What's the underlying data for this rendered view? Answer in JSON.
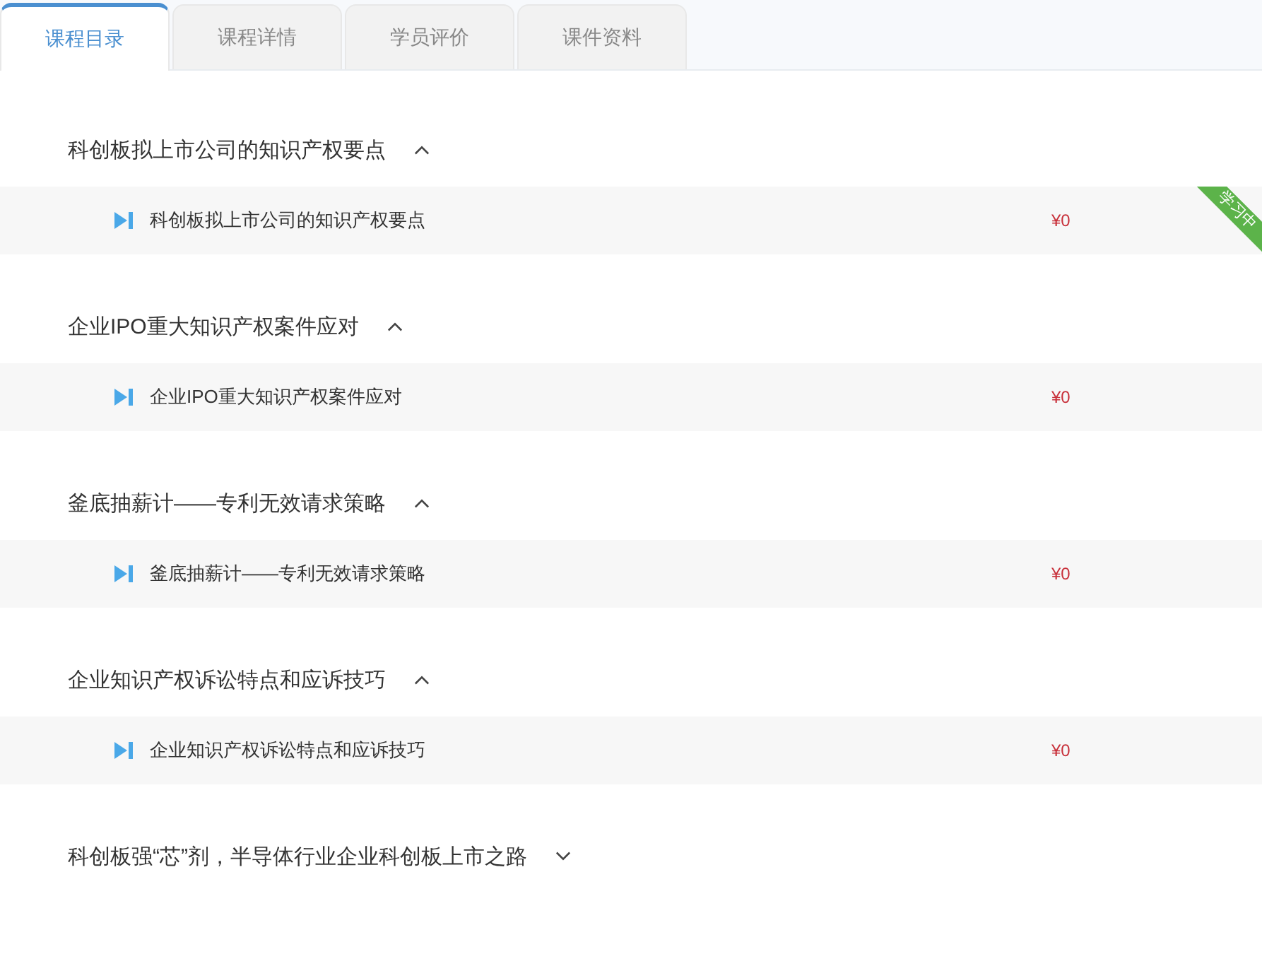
{
  "tabs": [
    {
      "label": "课程目录",
      "selected": true
    },
    {
      "label": "课程详情",
      "selected": false
    },
    {
      "label": "学员评价",
      "selected": false
    },
    {
      "label": "课件资料",
      "selected": false
    }
  ],
  "sections": [
    {
      "title": "科创板拟上市公司的知识产权要点",
      "expanded": true,
      "lessons": [
        {
          "title": "科创板拟上市公司的知识产权要点",
          "price": "¥0",
          "badge": "学习中"
        }
      ]
    },
    {
      "title": "企业IPO重大知识产权案件应对",
      "expanded": true,
      "lessons": [
        {
          "title": "企业IPO重大知识产权案件应对",
          "price": "¥0"
        }
      ]
    },
    {
      "title": "釜底抽薪计——专利无效请求策略",
      "expanded": true,
      "lessons": [
        {
          "title": "釜底抽薪计——专利无效请求策略",
          "price": "¥0"
        }
      ]
    },
    {
      "title": "企业知识产权诉讼特点和应诉技巧",
      "expanded": true,
      "lessons": [
        {
          "title": "企业知识产权诉讼特点和应诉技巧",
          "price": "¥0"
        }
      ]
    },
    {
      "title": "科创板强“芯”剂，半导体行业企业科创板上市之路",
      "expanded": false
    }
  ]
}
